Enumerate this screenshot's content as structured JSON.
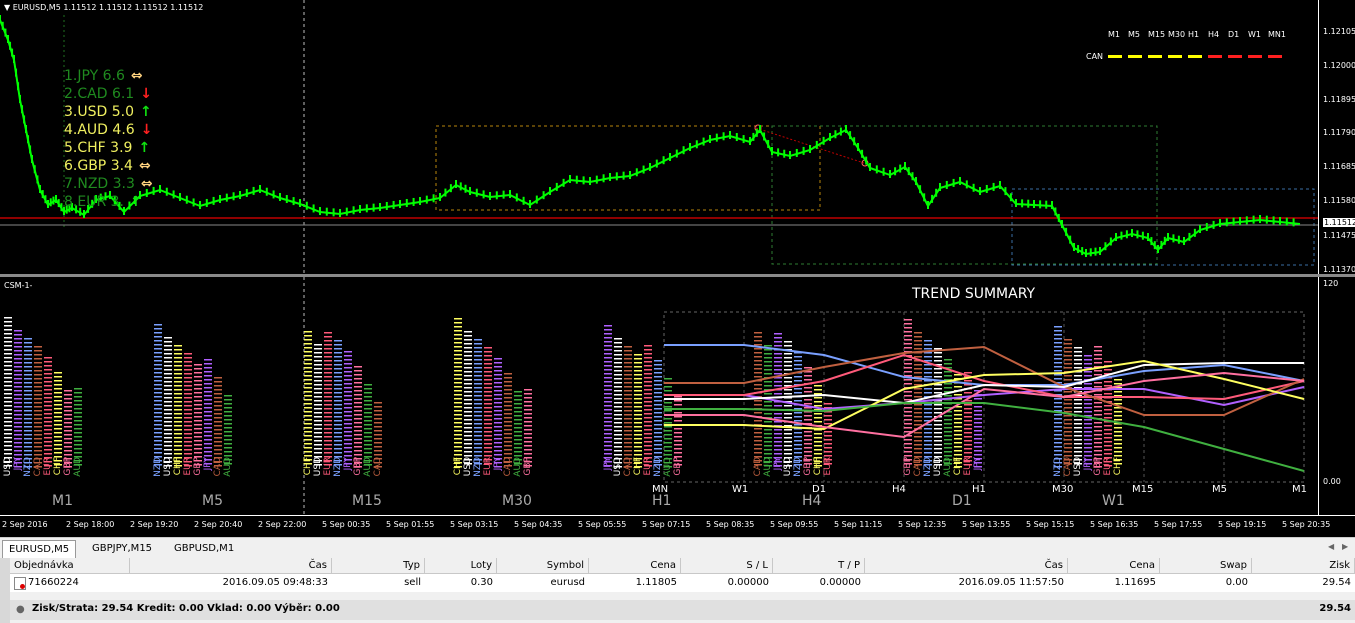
{
  "chart": {
    "title": "EURUSD,M5",
    "ohlc": "1.11512 1.11512 1.11512 1.11512",
    "price_ticks": [
      "1.12105",
      "1.12000",
      "1.11895",
      "1.11790",
      "1.11685",
      "1.11580",
      "1.11512",
      "1.11475",
      "1.11370"
    ],
    "current_price": "1.11512",
    "bid_color": "#ff0000",
    "candle_color": "#00ff00"
  },
  "strength_list": [
    {
      "rank": "1.",
      "ccy": "JPY",
      "value": "6.6",
      "arrow": "⇔",
      "color": "#1f8a1f",
      "arrow_color": "#ffd27f"
    },
    {
      "rank": "2.",
      "ccy": "CAD",
      "value": "6.1",
      "arrow": "↓",
      "color": "#1f8a1f",
      "arrow_color": "#ff2020"
    },
    {
      "rank": "3.",
      "ccy": "USD",
      "value": "5.0",
      "arrow": "↑",
      "color": "#f0f060",
      "arrow_color": "#10e010"
    },
    {
      "rank": "4.",
      "ccy": "AUD",
      "value": "4.6",
      "arrow": "↓",
      "color": "#f0f060",
      "arrow_color": "#ff2020"
    },
    {
      "rank": "5.",
      "ccy": "CHF",
      "value": "3.9",
      "arrow": "↑",
      "color": "#f0f060",
      "arrow_color": "#10e010"
    },
    {
      "rank": "6.",
      "ccy": "GBP",
      "value": "3.4",
      "arrow": "⇔",
      "color": "#f0f060",
      "arrow_color": "#ffd27f"
    },
    {
      "rank": "7.",
      "ccy": "NZD",
      "value": "3.3",
      "arrow": "⇔",
      "color": "#1f8a1f",
      "arrow_color": "#ffd27f"
    },
    {
      "rank": "8.",
      "ccy": "EUR",
      "value": "3.",
      "arrow": "↑",
      "color": "#1f8a1f",
      "arrow_color": "#10e010"
    }
  ],
  "timeframe_header": [
    "M1",
    "M5",
    "M15",
    "M30",
    "H1",
    "H4",
    "D1",
    "W1",
    "MN1"
  ],
  "can_row": {
    "label": "CAN",
    "segments": [
      "#ffff00",
      "#ffff00",
      "#ffff00",
      "#ffff00",
      "#ffff00",
      "#ff2020",
      "#ff2020",
      "#ff2020",
      "#ff2020"
    ]
  },
  "indicator": {
    "name": "CSM-1-",
    "title": "TREND SUMMARY",
    "axis_top": "120",
    "axis_bottom": "0.00",
    "groups": [
      {
        "tf": "M1",
        "currencies": [
          "USD",
          "JPY",
          "NZD",
          "CAD",
          "EUR",
          "CHF",
          "GBP",
          "AUD"
        ]
      },
      {
        "tf": "M5",
        "currencies": [
          "NZD",
          "USD",
          "CHF",
          "EUR",
          "GBP",
          "JPY",
          "CAD",
          "AUD"
        ]
      },
      {
        "tf": "M15",
        "currencies": [
          "CHF",
          "USD",
          "EUR",
          "NZD",
          "JPY",
          "GBP",
          "AUD",
          "CAD"
        ]
      },
      {
        "tf": "M30",
        "currencies": [
          "CHF",
          "USD",
          "NZD",
          "EUR",
          "JPY",
          "CAD",
          "AUD",
          "GBP"
        ]
      },
      {
        "tf": "H1",
        "currencies": [
          "JPY",
          "USD",
          "CAD",
          "CHF",
          "EUR",
          "NZD",
          "AUD",
          "GBP"
        ]
      },
      {
        "tf": "H4",
        "currencies": [
          "CAD",
          "AUD",
          "JPY",
          "USD",
          "NZD",
          "GBP",
          "CHF",
          "EUR"
        ]
      },
      {
        "tf": "D1",
        "currencies": [
          "GBP",
          "CAD",
          "NZD",
          "USD",
          "AUD",
          "CHF",
          "EUR",
          "JPY"
        ]
      },
      {
        "tf": "W1",
        "currencies": [
          "NZD",
          "CAD",
          "USD",
          "JPY",
          "GBP",
          "EUR",
          "CHF"
        ]
      }
    ],
    "summary_x_labels": [
      "MN",
      "W1",
      "D1",
      "H4",
      "H1",
      "M30",
      "M15",
      "M5",
      "M1"
    ]
  },
  "time_axis": [
    "2 Sep 2016",
    "2 Sep 18:00",
    "2 Sep 19:20",
    "2 Sep 20:40",
    "2 Sep 22:00",
    "5 Sep 00:35",
    "5 Sep 01:55",
    "5 Sep 03:15",
    "5 Sep 04:35",
    "5 Sep 05:55",
    "5 Sep 07:15",
    "5 Sep 08:35",
    "5 Sep 09:55",
    "5 Sep 11:15",
    "5 Sep 12:35",
    "5 Sep 13:55",
    "5 Sep 15:15",
    "5 Sep 16:35",
    "5 Sep 17:55",
    "5 Sep 19:15",
    "5 Sep 20:35"
  ],
  "tabs": [
    "EURUSD,M5",
    "GBPJPY,M15",
    "GBPUSD,M1"
  ],
  "terminal": {
    "headers": [
      "Objednávka",
      "Čas",
      "Typ",
      "Loty",
      "Symbol",
      "Cena",
      "S / L",
      "T / P",
      "Čas",
      "Cena",
      "Swap",
      "Zisk"
    ],
    "row": [
      "71660224",
      "2016.09.05 09:48:33",
      "sell",
      "0.30",
      "eurusd",
      "1.11805",
      "0.00000",
      "0.00000",
      "2016.09.05 11:57:50",
      "1.11695",
      "0.00",
      "29.54"
    ],
    "summary": "Zisk/Strata: 29.54  Kredit: 0.00  Vklad: 0.00  Výběr: 0.00",
    "summary_total": "29.54"
  }
}
